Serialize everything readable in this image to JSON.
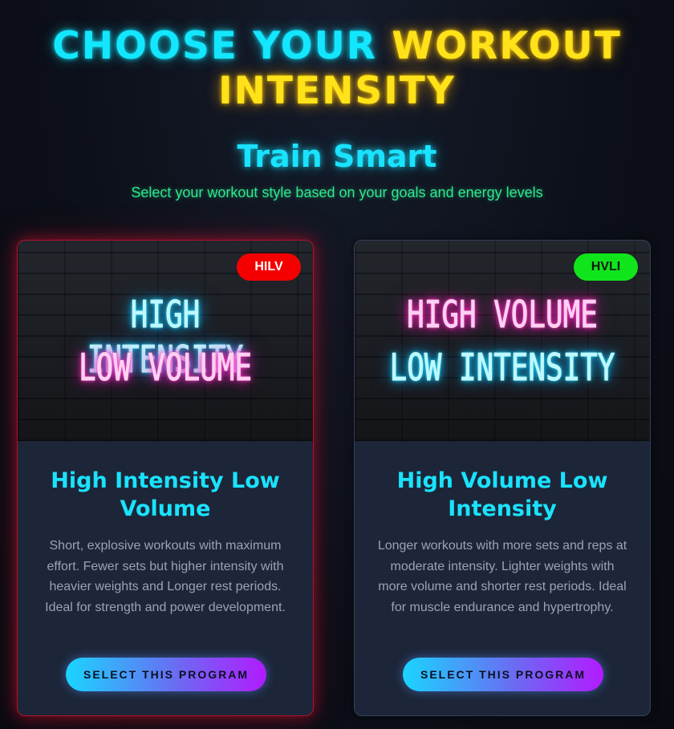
{
  "header": {
    "title_part1": "CHOOSE YOUR ",
    "title_part2": "WORKOUT",
    "title_part3": "INTENSITY",
    "subtitle": "Train Smart",
    "tagline": "Select your workout style based on your goals and energy levels"
  },
  "cards": [
    {
      "badge": "HILV",
      "neon_line1": "HIGH INTENSITY",
      "neon_line2": "LOW VOLUME",
      "title": "High Intensity Low Volume",
      "description": "Short, explosive workouts with maximum effort. Fewer sets but higher intensity with heavier weights and Longer rest periods. Ideal for strength and power development.",
      "button_label": "SELECT THIS PROGRAM"
    },
    {
      "badge": "HVLI",
      "neon_line1": "HIGH VOLUME",
      "neon_line2": "LOW INTENSITY",
      "title": "High Volume Low Intensity",
      "description": "Longer workouts with more sets and reps at moderate intensity. Lighter weights with more volume and shorter rest periods. Ideal for muscle endurance and hypertrophy.",
      "button_label": "SELECT THIS PROGRAM"
    }
  ],
  "colors": {
    "accent_cyan": "#13e7ff",
    "accent_yellow": "#ffe21a",
    "tagline_green": "#2ee88f",
    "badge_hilv": "#f50000",
    "badge_hvli": "#10e51c",
    "card_left_border": "#b3112a",
    "button_gradient_start": "#1ad5ff",
    "button_gradient_end": "#b21bff"
  }
}
